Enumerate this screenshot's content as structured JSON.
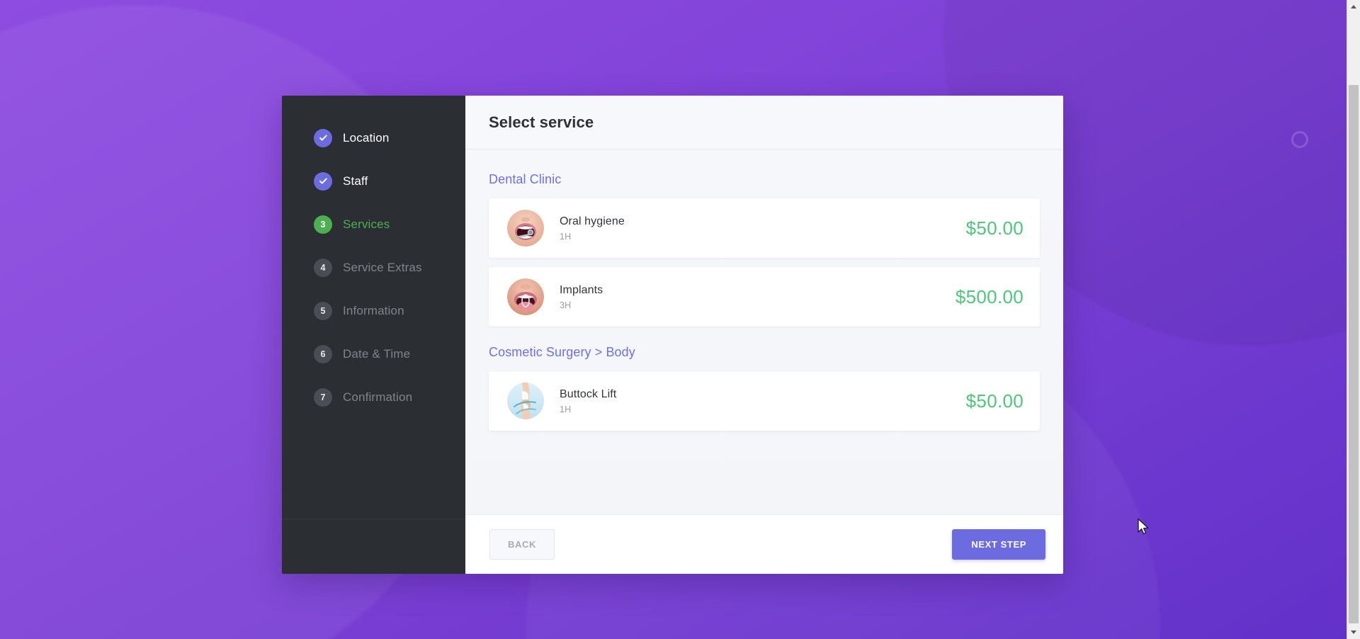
{
  "background": {
    "gradient_from": "#8e4ce0",
    "gradient_to": "#6231c9"
  },
  "sidebar": {
    "steps": [
      {
        "number": "1",
        "label": "Location",
        "state": "done"
      },
      {
        "number": "2",
        "label": "Staff",
        "state": "done"
      },
      {
        "number": "3",
        "label": "Services",
        "state": "active"
      },
      {
        "number": "4",
        "label": "Service Extras",
        "state": "todo"
      },
      {
        "number": "5",
        "label": "Information",
        "state": "todo"
      },
      {
        "number": "6",
        "label": "Date & Time",
        "state": "todo"
      },
      {
        "number": "7",
        "label": "Confirmation",
        "state": "todo"
      }
    ],
    "colors": {
      "background": "#2b2e33",
      "done_badge": "#6c6ce0",
      "active_badge": "#4caf50",
      "todo_badge": "#4a4d53",
      "active_label": "#4caf50",
      "todo_label": "#80848b"
    }
  },
  "header": {
    "title": "Select service"
  },
  "main": {
    "categories": [
      {
        "title": "Dental Clinic",
        "services": [
          {
            "name": "Oral hygiene",
            "duration": "1H",
            "price": "$50.00",
            "thumb": "open-mouth-dental-mirror-photo"
          },
          {
            "name": "Implants",
            "duration": "3H",
            "price": "$500.00",
            "thumb": "mouth-implant-photo"
          }
        ]
      },
      {
        "title": "Cosmetic Surgery > Body",
        "services": [
          {
            "name": "Buttock Lift",
            "duration": "1H",
            "price": "$50.00",
            "thumb": "body-contour-photo"
          }
        ]
      }
    ],
    "colors": {
      "category_title": "#6f6fe8",
      "price": "#4ec77a",
      "service_name": "#32343a",
      "duration": "#9a9ea8"
    }
  },
  "footer": {
    "back_label": "BACK",
    "next_label": "NEXT STEP",
    "next_color": "#6c6ce0"
  },
  "scrollbar": {
    "up_arrow": "scroll-up-arrow-icon",
    "down_arrow": "scroll-down-arrow-icon"
  },
  "cursor": {
    "icon": "mouse-pointer"
  }
}
